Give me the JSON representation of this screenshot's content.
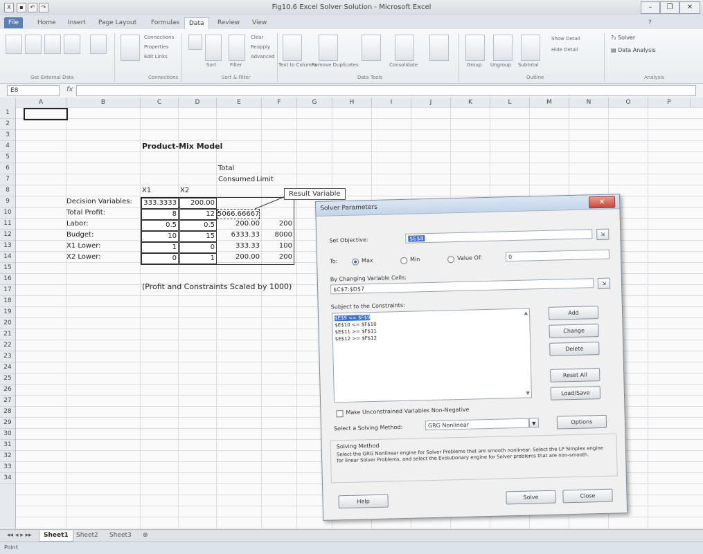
{
  "window": {
    "title": "Fig10.6 Excel Solver Solution - Microsoft Excel",
    "min": "–",
    "max": "❐",
    "close": "✕"
  },
  "ribbon": {
    "tabs": [
      "File",
      "Home",
      "Insert",
      "Page Layout",
      "Formulas",
      "Data",
      "Review",
      "View"
    ],
    "active_tab": "Data",
    "groups": {
      "get_external": "Get External Data",
      "connections": "Connections",
      "sort_filter": "Sort & Filter",
      "data_tools": "Data Tools",
      "outline": "Outline",
      "analysis": "Analysis"
    },
    "labels": {
      "connections": "Connections",
      "properties": "Properties",
      "edit_links": "Edit Links",
      "sort": "Sort",
      "filter": "Filter",
      "clear": "Clear",
      "reapply": "Reapply",
      "advanced": "Advanced",
      "text_to_columns": "Text to Columns",
      "remove_duplicates": "Remove Duplicates",
      "consolidate": "Consolidate",
      "group": "Group",
      "ungroup": "Ungroup",
      "subtotal": "Subtotal",
      "show_detail": "Show Detail",
      "hide_detail": "Hide Detail",
      "solver": "Solver",
      "data_analysis": "Data Analysis"
    }
  },
  "formula_bar": {
    "name_box": "E8",
    "fx": "fx"
  },
  "columns": [
    "A",
    "B",
    "C",
    "D",
    "E",
    "F",
    "G",
    "H",
    "I",
    "J",
    "K",
    "L",
    "M",
    "N",
    "O",
    "P"
  ],
  "rows": [
    "1",
    "2",
    "3",
    "4",
    "5",
    "6",
    "7",
    "8",
    "9",
    "10",
    "11",
    "12",
    "13",
    "14",
    "15",
    "16",
    "17",
    "18",
    "19",
    "20",
    "21",
    "22",
    "23",
    "24",
    "25",
    "26",
    "27",
    "28",
    "29",
    "30",
    "31",
    "32",
    "33",
    "34"
  ],
  "sheet": {
    "title": "Product-Mix Model",
    "hdr_total": "Total",
    "hdr_consumed": "Consumed",
    "hdr_limit": "Limit",
    "hdr_x1": "X1",
    "hdr_x2": "X2",
    "labels": [
      "Decision Variables:",
      "Total Profit:",
      "Labor:",
      "Budget:",
      "X1 Lower:",
      "X2 Lower:"
    ],
    "x1": [
      "333.3333",
      "8",
      "0.5",
      "10",
      "1",
      "0"
    ],
    "x2": [
      "200.00",
      "12",
      "0.5",
      "15",
      "0",
      "1"
    ],
    "consumed": [
      "",
      "5066.66667",
      "200.00",
      "6333.33",
      "333.33",
      "200.00"
    ],
    "limit": [
      "",
      "",
      "200",
      "8000",
      "100",
      "200"
    ],
    "note": "(Profit and Constraints Scaled by 1000)",
    "callout": "Result Variable"
  },
  "dialog": {
    "title": "Solver Parameters",
    "set_objective_label": "Set Objective:",
    "set_objective_value": "$E$8",
    "to_label": "To:",
    "max": "Max",
    "min": "Min",
    "value_of": "Value Of:",
    "value_of_value": "0",
    "changing_label": "By Changing Variable Cells:",
    "changing_value": "$C$7:$D$7",
    "constraints_label": "Subject to the Constraints:",
    "constraints": [
      "$E$9 <= $F$9",
      "$E$10 <= $F$10",
      "$E$11 >= $F$11",
      "$E$12 >= $F$12"
    ],
    "add": "Add",
    "change": "Change",
    "delete": "Delete",
    "reset_all": "Reset All",
    "load_save": "Load/Save",
    "nonneg_label": "Make Unconstrained Variables Non-Negative",
    "method_label": "Select a Solving Method:",
    "method_value": "GRG Nonlinear",
    "options": "Options",
    "solving_method_title": "Solving Method",
    "solving_method_text": "Select the GRG Nonlinear engine for Solver Problems that are smooth nonlinear. Select the LP Simplex engine for linear Solver Problems, and select the Evolutionary engine for Solver problems that are non-smooth.",
    "help": "Help",
    "solve": "Solve",
    "close": "Close"
  },
  "sheet_tabs": [
    "Sheet1",
    "Sheet2",
    "Sheet3"
  ],
  "status": "Point"
}
